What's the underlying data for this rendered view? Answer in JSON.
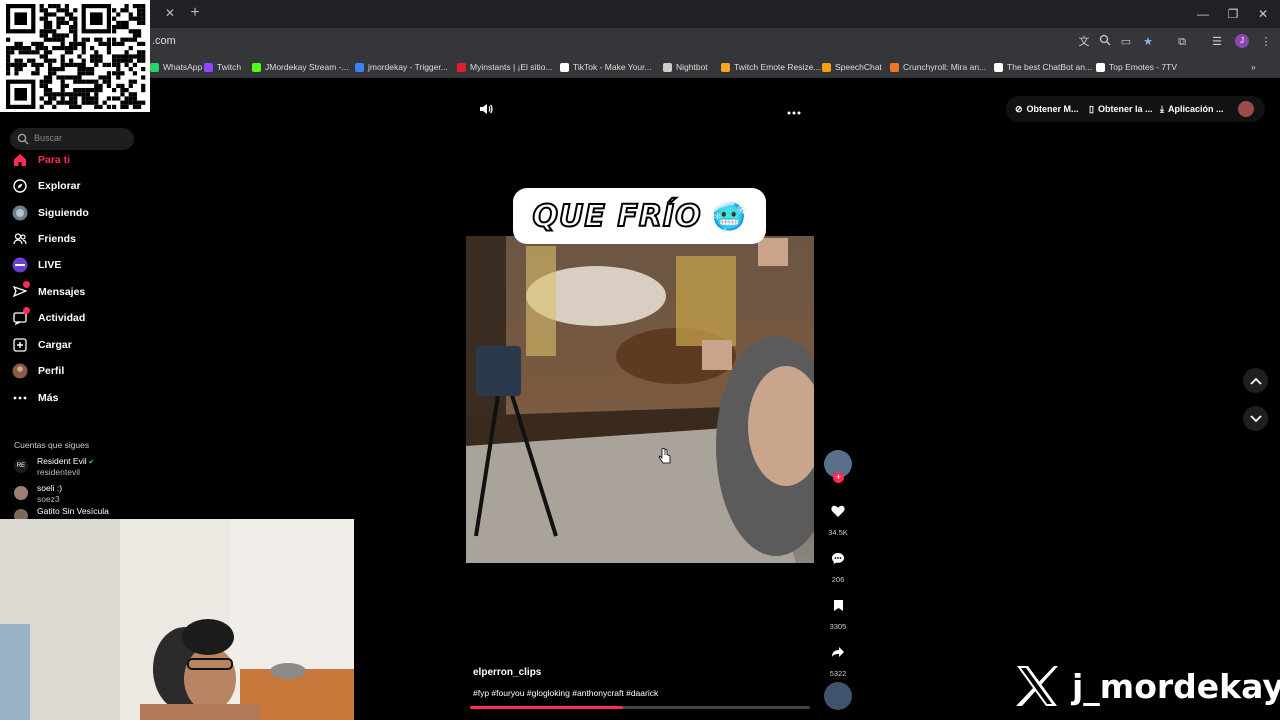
{
  "browser": {
    "url": ".com",
    "bookmarks": [
      {
        "label": "WhatsApp",
        "icon": "whatsapp-icon",
        "color": "#25d366"
      },
      {
        "label": "Twitch",
        "icon": "twitch-icon",
        "color": "#9146ff"
      },
      {
        "label": "JMordekay Stream -...",
        "icon": "kick-icon",
        "color": "#53fc18"
      },
      {
        "label": "jmordekay - Trigger...",
        "icon": "trigger-icon",
        "color": "#3b82f6"
      },
      {
        "label": "Myinstants | ¡El sitio...",
        "icon": "myinstants-icon",
        "color": "#e11d2b"
      },
      {
        "label": "TikTok - Make Your...",
        "icon": "tiktok-icon",
        "color": "#ffffff"
      },
      {
        "label": "Nightbot",
        "icon": "nightbot-icon",
        "color": "#cccccc"
      },
      {
        "label": "Twitch Emote Resize...",
        "icon": "emote-icon",
        "color": "#f5a623"
      },
      {
        "label": "SpeechChat",
        "icon": "speechchat-icon",
        "color": "#f59e0b"
      },
      {
        "label": "Crunchyroll: Mira an...",
        "icon": "crunchyroll-icon",
        "color": "#f47521"
      },
      {
        "label": "The best ChatBot an...",
        "icon": "chatbot-icon",
        "color": "#ffffff"
      },
      {
        "label": "Top Emotes - 7TV",
        "icon": "7tv-icon",
        "color": "#ffffff"
      }
    ],
    "profile_initial": "J"
  },
  "sidebar": {
    "search_placeholder": "Buscar",
    "nav": [
      {
        "label": "Para ti",
        "icon": "home-icon",
        "active": true
      },
      {
        "label": "Explorar",
        "icon": "compass-icon"
      },
      {
        "label": "Siguiendo",
        "icon": "following-icon"
      },
      {
        "label": "Friends",
        "icon": "friends-icon"
      },
      {
        "label": "LIVE",
        "icon": "live-icon"
      },
      {
        "label": "Mensajes",
        "icon": "messages-icon",
        "badge": true
      },
      {
        "label": "Actividad",
        "icon": "activity-icon",
        "badge": true
      },
      {
        "label": "Cargar",
        "icon": "upload-icon"
      },
      {
        "label": "Perfil",
        "icon": "profile-icon"
      },
      {
        "label": "Más",
        "icon": "more-icon"
      }
    ],
    "following_title": "Cuentas que sigues",
    "accounts": [
      {
        "name": "Resident Evil",
        "handle": "residentevil",
        "verified": true
      },
      {
        "name": "soeli :)",
        "handle": "soez3"
      },
      {
        "name": "Gatito Sin Vesícula",
        "handle": ""
      }
    ]
  },
  "topbar": {
    "get_m": "Obtener M...",
    "get_la": "Obtener la ...",
    "app": "Aplicación ..."
  },
  "video": {
    "caption": "QUE FRÍO",
    "caption_emoji": "🥶",
    "author": "elperron_clips",
    "hashtags": "#fyp #fouryou #glogloking #anthonycraft #daarick",
    "progress": 0.45
  },
  "actions": {
    "likes": "34.5K",
    "comments": "206",
    "saves": "3305",
    "shares": "5322"
  },
  "watermark": {
    "handle": "j_mordekay"
  },
  "colors": {
    "accent": "#fe2c55"
  }
}
